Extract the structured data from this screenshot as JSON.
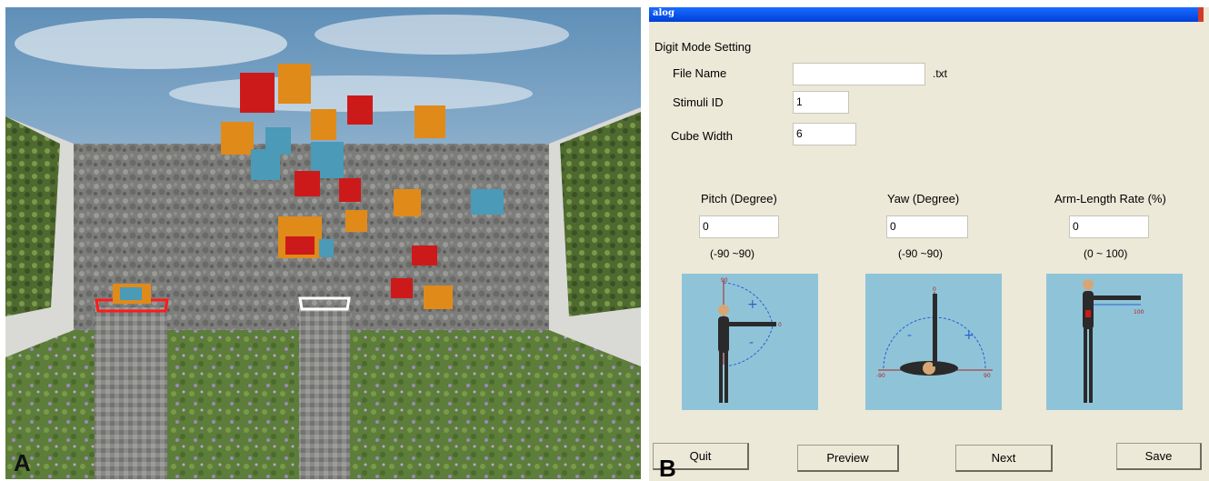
{
  "panel_a": {
    "letter": "A"
  },
  "dialog": {
    "title": "alog",
    "section_title": "Digit Mode Setting",
    "file_name": {
      "label": "File Name",
      "value": "",
      "suffix": ".txt"
    },
    "stimuli_id": {
      "label": "Stimuli ID",
      "value": "1"
    },
    "cube_width": {
      "label": "Cube Width",
      "value": "6"
    },
    "pitch": {
      "label": "Pitch (Degree)",
      "value": "0",
      "range": "(-90 ~90)"
    },
    "yaw": {
      "label": "Yaw (Degree)",
      "value": "0",
      "range": "(-90 ~90)"
    },
    "arm_length": {
      "label": "Arm-Length Rate (%)",
      "value": "0",
      "range": "(0 ~ 100)"
    },
    "figures": {
      "pitch_top": "90",
      "pitch_mid": "0",
      "pitch_plus": "+",
      "pitch_minus": "-",
      "yaw_top": "0",
      "yaw_left": "-90",
      "yaw_right": "90",
      "yaw_plus": "+",
      "yaw_minus": "-",
      "arm_value": "100"
    },
    "buttons": {
      "quit": "Quit",
      "preview": "Preview",
      "next": "Next",
      "save": "Save"
    },
    "letter": "B"
  },
  "colors": {
    "titlebar": "#0040d8",
    "dialog_bg": "#ece9d8",
    "figure_bg": "#8fc4d8",
    "cube_red": "#cc1a1a",
    "cube_orange": "#e08a1a",
    "cube_blue": "#4a9ab8"
  }
}
